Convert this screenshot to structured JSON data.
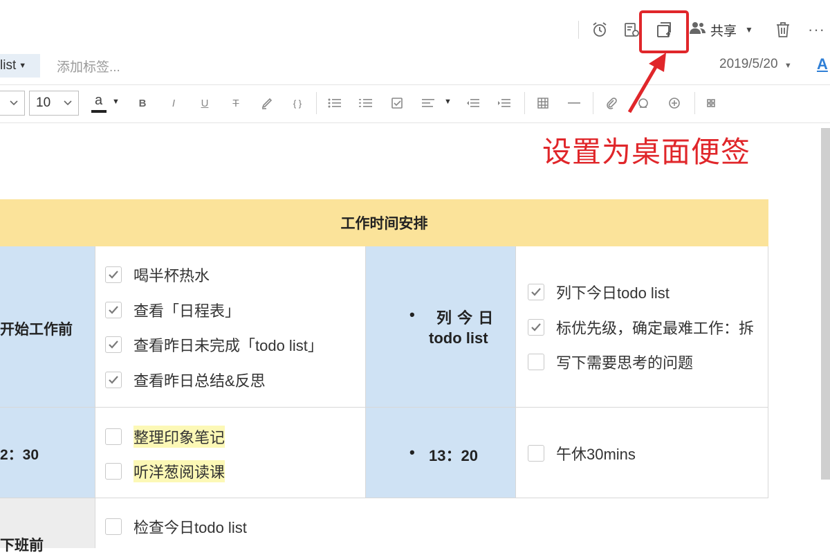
{
  "header": {
    "share_label": "共享",
    "icons": [
      "alarm-icon",
      "present-icon",
      "desktop-note-icon",
      "share-people-icon",
      "trash-icon",
      "more-icon"
    ],
    "more_glyph": "···"
  },
  "tags": {
    "current_tag": "list",
    "add_tag_placeholder": "添加标签..."
  },
  "meta": {
    "date": "2019/5/20",
    "font_a": "A"
  },
  "toolbar": {
    "font_size": "10",
    "font_color_glyph": "a"
  },
  "annotation": {
    "text": "设置为桌面便签",
    "color": "#e0262a"
  },
  "table": {
    "title": "工作时间安排",
    "rows": [
      {
        "label": "开始工作前",
        "items": [
          {
            "text": "喝半杯热水",
            "checked": true
          },
          {
            "text": "查看「日程表」",
            "checked": true
          },
          {
            "text": "查看昨日未完成「todo list」",
            "checked": true
          },
          {
            "text": "查看昨日总结&反思",
            "checked": true
          }
        ],
        "bullet_line1": "列 今 日",
        "bullet_line2": "todo list",
        "items2": [
          {
            "text": "列下今日todo list",
            "checked": true
          },
          {
            "text": "标优先级，确定最难工作：拆",
            "checked": true
          },
          {
            "text": "写下需要思考的问题",
            "checked": false
          }
        ]
      },
      {
        "label": "2：30",
        "items": [
          {
            "text": "整理印象笔记",
            "checked": false,
            "highlight": true
          },
          {
            "text": "听洋葱阅读课",
            "checked": false,
            "highlight": true
          }
        ],
        "bullet": "13：20",
        "items2": [
          {
            "text": "午休30mins",
            "checked": false
          }
        ]
      },
      {
        "label": "下班前",
        "items": [
          {
            "text": "检查今日todo list",
            "checked": false
          }
        ]
      }
    ]
  },
  "colors": {
    "header_yellow": "#fbe39a",
    "cell_blue": "#cfe2f4",
    "highlight_yellow": "#fcf8b6",
    "accent_blue": "#2f7fd6"
  }
}
